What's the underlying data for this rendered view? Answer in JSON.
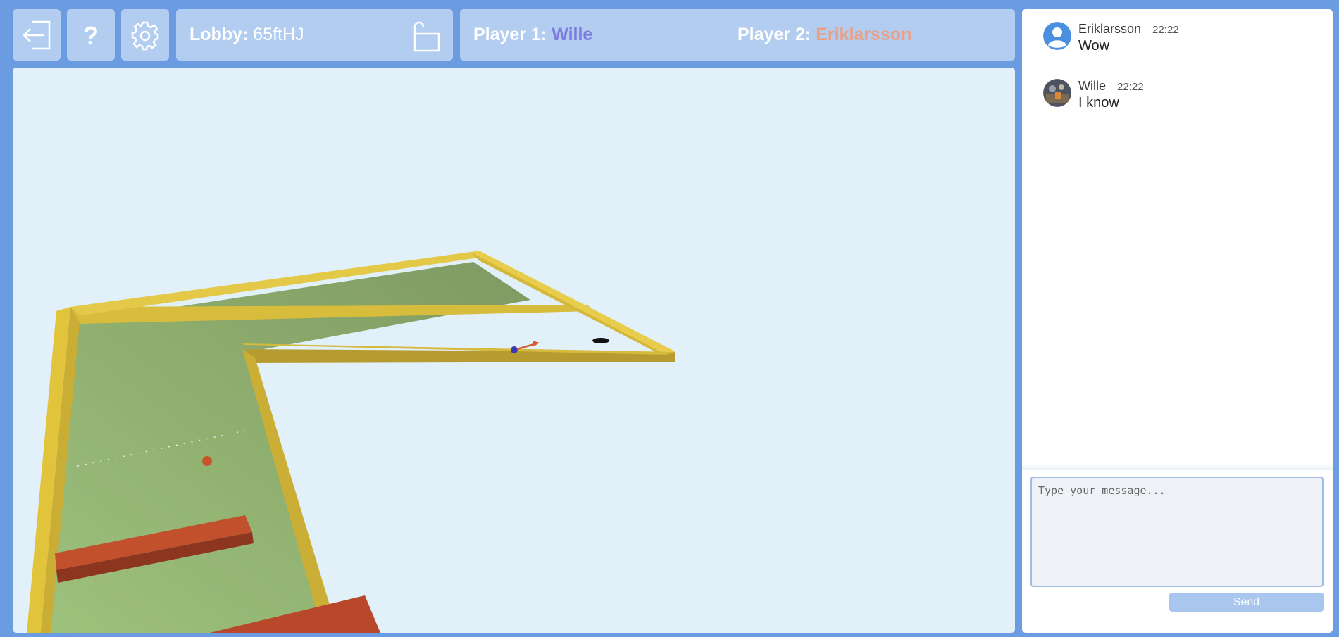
{
  "toolbar": {
    "exit_icon": "exit-icon",
    "help_icon": "help-icon",
    "settings_icon": "gear-icon"
  },
  "lobby": {
    "label": "Lobby:",
    "code": "65ftHJ",
    "lock_icon": "unlocked-padlock-icon"
  },
  "players": {
    "player1_label": "Player 1:",
    "player1_name": "Wille",
    "player1_color": "#7b7be0",
    "player2_label": "Player 2:",
    "player2_name": "Eriklarsson",
    "player2_color": "#e9a088"
  },
  "chat": {
    "messages": [
      {
        "user": "Eriklarsson",
        "time": "22:22",
        "text": "Wow",
        "avatar": "default-user-icon"
      },
      {
        "user": "Wille",
        "time": "22:22",
        "text": "I know",
        "avatar": "user-photo"
      }
    ],
    "input_placeholder": "Type your message...",
    "send_label": "Send"
  },
  "colors": {
    "background": "#6b9be0",
    "panel": "#b2cdf0",
    "game_bg": "#e2f0fa",
    "course_green": "#8fb06e",
    "course_wall": "#d4b83a",
    "obstacle": "#b84a2c"
  }
}
